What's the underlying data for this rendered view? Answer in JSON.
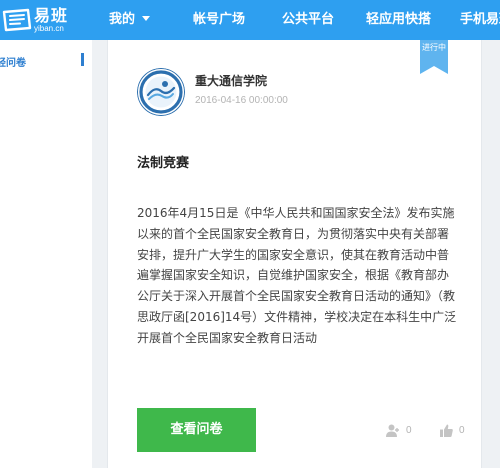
{
  "header": {
    "logo_title": "易班",
    "logo_sub": "yiban.cn",
    "nav": [
      {
        "label": "我的"
      },
      {
        "label": "帐号广场"
      },
      {
        "label": "公共平台"
      },
      {
        "label": "轻应用快搭"
      },
      {
        "label": "手机易班"
      }
    ]
  },
  "sidebar": {
    "items": [
      {
        "label": "轻问卷"
      }
    ]
  },
  "card": {
    "status_ribbon": "进行中",
    "org_name": "重大通信学院",
    "date": "2016-04-16 00:00:00",
    "title": "法制竞赛",
    "description": "2016年4月15日是《中华人民共和国国家安全法》发布实施以来的首个全民国家安全教育日，为贯彻落实中央有关部署安排，提升广大学生的国家安全意识，使其在教育活动中普遍掌握国家安全知识，自觉维护国家安全，根据《教育部办公厅关于深入开展首个全民国家安全教育日活动的通知》（教思政厅函[2016]14号）文件精神，学校决定在本科生中广泛开展首个全民国家安全教育日活动",
    "view_button": "查看问卷",
    "participants": "0",
    "likes": "0"
  },
  "colors": {
    "brand": "#2e9ff0",
    "button": "#3fb84b",
    "ribbon": "#5fb4ef",
    "sidebar_accent": "#2e7fd0"
  },
  "icons": [
    "yiban-logo-icon",
    "chevron-down-icon",
    "user-icon",
    "thumbs-up-icon"
  ]
}
